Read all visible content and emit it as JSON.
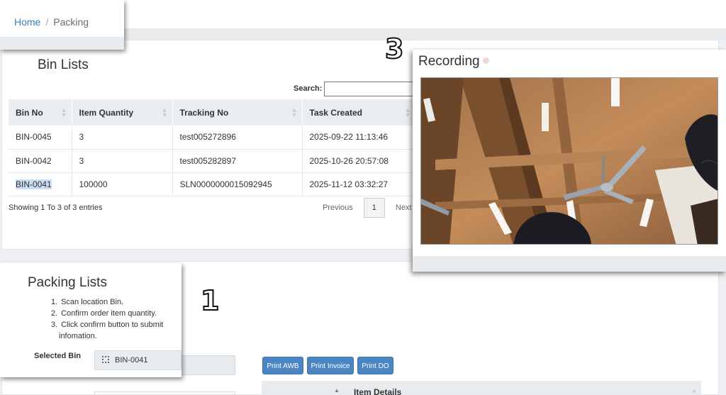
{
  "breadcrumb": {
    "home": "Home",
    "separator": "/",
    "current": "Packing"
  },
  "bin_list": {
    "title": "Bin Lists",
    "search_label": "Search:",
    "search_value": "",
    "columns": [
      "Bin No",
      "Item Quantity",
      "Tracking No",
      "Task Created"
    ],
    "rows": [
      [
        "BIN-0045",
        "3",
        "test005272896",
        "2025-09-22 11:13:46"
      ],
      [
        "BIN-0042",
        "3",
        "test005282897",
        "2025-10-26 20:57:08"
      ],
      [
        "BIN-0041",
        "100000",
        "SLN0000000015092945",
        "2025-11-12 03:32:27"
      ]
    ],
    "showing": "Showing 1 To 3 of 3 entries",
    "pager": {
      "previous": "Previous",
      "page": "1",
      "next": "Next"
    }
  },
  "packing": {
    "title": "Packing Lists",
    "steps": [
      {
        "num": "1.",
        "text": "Scan location Bin."
      },
      {
        "num": "2.",
        "text": "Confirm order item quantity."
      },
      {
        "num": "3.",
        "text": "Click confirm button to submit",
        "cont": "infomation."
      }
    ],
    "selected_label": "Selected Bin",
    "selected_value": "BIN-0041",
    "buttons": {
      "awb": "Print AWB",
      "invoice": "Print Invoice",
      "do": "Print DO"
    },
    "items_header": "Item Details"
  },
  "recording": {
    "title": "Recording"
  },
  "markers": {
    "one": "1",
    "three": "3"
  },
  "colors": {
    "link": "#3c7fb8",
    "button": "#4b86c2",
    "table_header": "#e9eef3",
    "highlight": "#c8dcf3"
  }
}
